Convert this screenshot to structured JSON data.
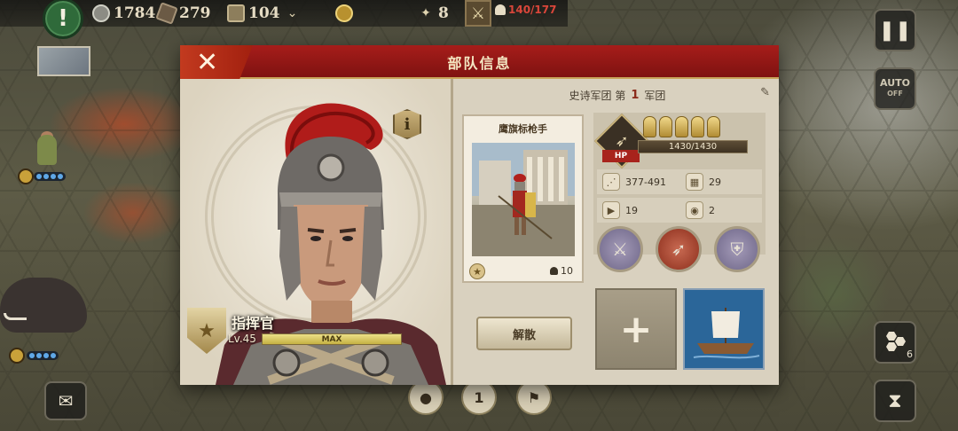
{
  "topbar": {
    "alert_symbol": "!",
    "resources": [
      {
        "icon": "silver-icon",
        "value": "1784"
      },
      {
        "icon": "wood-icon",
        "value": "279"
      },
      {
        "icon": "food-icon",
        "value": "104"
      }
    ],
    "troop_count": "140/177",
    "moves": "8"
  },
  "side_buttons": {
    "auto_label": "AUTO",
    "auto_state": "OFF",
    "hex_badge": "6"
  },
  "bottom_tab_number": "1",
  "dialog": {
    "title": "部队信息",
    "close_symbol": "✕",
    "commander": {
      "info_symbol": "i",
      "name": "指挥官",
      "level": "Lv.45",
      "exp_label": "MAX",
      "exp_fraction": 1.0
    },
    "legion": {
      "prefix": "史诗军团 第",
      "number": "1",
      "suffix": "军团"
    },
    "unit": {
      "name": "鹰旗标枪手",
      "count": "10",
      "hp_text": "1430/1430",
      "hp_fraction": 1.0,
      "hp_tag": "HP",
      "helmets": 5,
      "attack": "377-491",
      "defense": "29",
      "movement": "19",
      "vision": "2"
    },
    "dismiss_label": "解散",
    "add_symbol": "+"
  },
  "colors": {
    "header_red": "#8f1816",
    "gold_accent": "#c9a45a",
    "panel_beige": "#e8e1d2"
  }
}
